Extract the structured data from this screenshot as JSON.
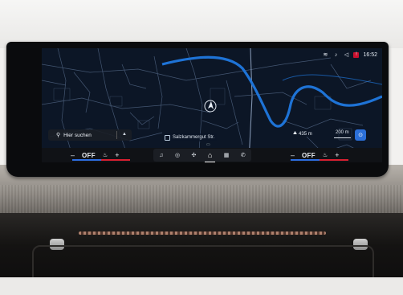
{
  "status_bar": {
    "icons": [
      "wireless-charging-icon",
      "music-icon",
      "volume-icon",
      "notification-icon"
    ],
    "time": "16:52"
  },
  "map": {
    "search_placeholder": "Hier suchen",
    "street_name": "Salzkammergut Str.",
    "elevation": "435 m",
    "scale": "200 m",
    "colors": {
      "background": "#0c1626",
      "river": "#1e73d6",
      "roads": "#5a6b84",
      "position": "#e8eef6"
    }
  },
  "climate": {
    "left": {
      "minus": "–",
      "state": "OFF",
      "plus": "+"
    },
    "right": {
      "minus": "–",
      "state": "OFF",
      "plus": "+"
    }
  },
  "dock": {
    "items": [
      "music-icon",
      "driving-icon",
      "fan-icon",
      "home-icon",
      "apps-icon",
      "phone-icon"
    ]
  }
}
